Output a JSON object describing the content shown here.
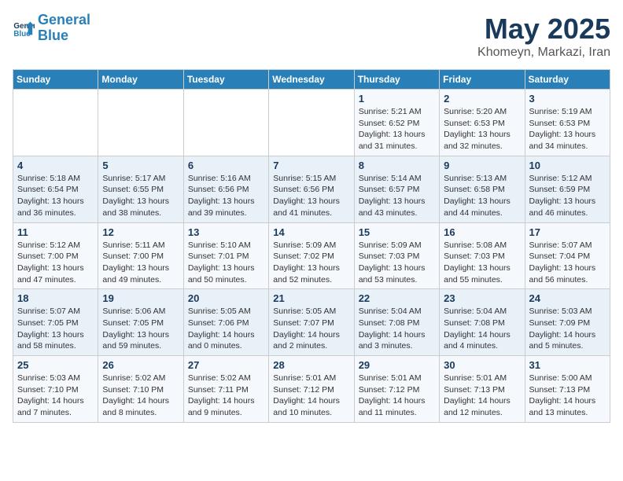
{
  "header": {
    "logo_line1": "General",
    "logo_line2": "Blue",
    "month_title": "May 2025",
    "subtitle": "Khomeyn, Markazi, Iran"
  },
  "weekdays": [
    "Sunday",
    "Monday",
    "Tuesday",
    "Wednesday",
    "Thursday",
    "Friday",
    "Saturday"
  ],
  "weeks": [
    [
      {
        "day": "",
        "info": ""
      },
      {
        "day": "",
        "info": ""
      },
      {
        "day": "",
        "info": ""
      },
      {
        "day": "",
        "info": ""
      },
      {
        "day": "1",
        "info": "Sunrise: 5:21 AM\nSunset: 6:52 PM\nDaylight: 13 hours\nand 31 minutes."
      },
      {
        "day": "2",
        "info": "Sunrise: 5:20 AM\nSunset: 6:53 PM\nDaylight: 13 hours\nand 32 minutes."
      },
      {
        "day": "3",
        "info": "Sunrise: 5:19 AM\nSunset: 6:53 PM\nDaylight: 13 hours\nand 34 minutes."
      }
    ],
    [
      {
        "day": "4",
        "info": "Sunrise: 5:18 AM\nSunset: 6:54 PM\nDaylight: 13 hours\nand 36 minutes."
      },
      {
        "day": "5",
        "info": "Sunrise: 5:17 AM\nSunset: 6:55 PM\nDaylight: 13 hours\nand 38 minutes."
      },
      {
        "day": "6",
        "info": "Sunrise: 5:16 AM\nSunset: 6:56 PM\nDaylight: 13 hours\nand 39 minutes."
      },
      {
        "day": "7",
        "info": "Sunrise: 5:15 AM\nSunset: 6:56 PM\nDaylight: 13 hours\nand 41 minutes."
      },
      {
        "day": "8",
        "info": "Sunrise: 5:14 AM\nSunset: 6:57 PM\nDaylight: 13 hours\nand 43 minutes."
      },
      {
        "day": "9",
        "info": "Sunrise: 5:13 AM\nSunset: 6:58 PM\nDaylight: 13 hours\nand 44 minutes."
      },
      {
        "day": "10",
        "info": "Sunrise: 5:12 AM\nSunset: 6:59 PM\nDaylight: 13 hours\nand 46 minutes."
      }
    ],
    [
      {
        "day": "11",
        "info": "Sunrise: 5:12 AM\nSunset: 7:00 PM\nDaylight: 13 hours\nand 47 minutes."
      },
      {
        "day": "12",
        "info": "Sunrise: 5:11 AM\nSunset: 7:00 PM\nDaylight: 13 hours\nand 49 minutes."
      },
      {
        "day": "13",
        "info": "Sunrise: 5:10 AM\nSunset: 7:01 PM\nDaylight: 13 hours\nand 50 minutes."
      },
      {
        "day": "14",
        "info": "Sunrise: 5:09 AM\nSunset: 7:02 PM\nDaylight: 13 hours\nand 52 minutes."
      },
      {
        "day": "15",
        "info": "Sunrise: 5:09 AM\nSunset: 7:03 PM\nDaylight: 13 hours\nand 53 minutes."
      },
      {
        "day": "16",
        "info": "Sunrise: 5:08 AM\nSunset: 7:03 PM\nDaylight: 13 hours\nand 55 minutes."
      },
      {
        "day": "17",
        "info": "Sunrise: 5:07 AM\nSunset: 7:04 PM\nDaylight: 13 hours\nand 56 minutes."
      }
    ],
    [
      {
        "day": "18",
        "info": "Sunrise: 5:07 AM\nSunset: 7:05 PM\nDaylight: 13 hours\nand 58 minutes."
      },
      {
        "day": "19",
        "info": "Sunrise: 5:06 AM\nSunset: 7:05 PM\nDaylight: 13 hours\nand 59 minutes."
      },
      {
        "day": "20",
        "info": "Sunrise: 5:05 AM\nSunset: 7:06 PM\nDaylight: 14 hours\nand 0 minutes."
      },
      {
        "day": "21",
        "info": "Sunrise: 5:05 AM\nSunset: 7:07 PM\nDaylight: 14 hours\nand 2 minutes."
      },
      {
        "day": "22",
        "info": "Sunrise: 5:04 AM\nSunset: 7:08 PM\nDaylight: 14 hours\nand 3 minutes."
      },
      {
        "day": "23",
        "info": "Sunrise: 5:04 AM\nSunset: 7:08 PM\nDaylight: 14 hours\nand 4 minutes."
      },
      {
        "day": "24",
        "info": "Sunrise: 5:03 AM\nSunset: 7:09 PM\nDaylight: 14 hours\nand 5 minutes."
      }
    ],
    [
      {
        "day": "25",
        "info": "Sunrise: 5:03 AM\nSunset: 7:10 PM\nDaylight: 14 hours\nand 7 minutes."
      },
      {
        "day": "26",
        "info": "Sunrise: 5:02 AM\nSunset: 7:10 PM\nDaylight: 14 hours\nand 8 minutes."
      },
      {
        "day": "27",
        "info": "Sunrise: 5:02 AM\nSunset: 7:11 PM\nDaylight: 14 hours\nand 9 minutes."
      },
      {
        "day": "28",
        "info": "Sunrise: 5:01 AM\nSunset: 7:12 PM\nDaylight: 14 hours\nand 10 minutes."
      },
      {
        "day": "29",
        "info": "Sunrise: 5:01 AM\nSunset: 7:12 PM\nDaylight: 14 hours\nand 11 minutes."
      },
      {
        "day": "30",
        "info": "Sunrise: 5:01 AM\nSunset: 7:13 PM\nDaylight: 14 hours\nand 12 minutes."
      },
      {
        "day": "31",
        "info": "Sunrise: 5:00 AM\nSunset: 7:13 PM\nDaylight: 14 hours\nand 13 minutes."
      }
    ]
  ]
}
